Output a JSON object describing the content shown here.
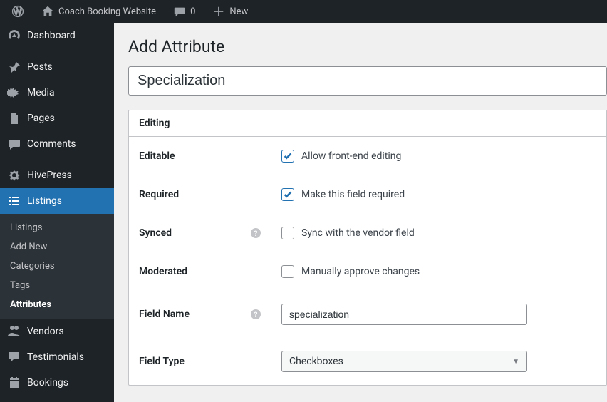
{
  "adminbar": {
    "site_name": "Coach Booking Website",
    "comments_count": "0",
    "new_label": "New"
  },
  "sidebar": {
    "dashboard": "Dashboard",
    "posts": "Posts",
    "media": "Media",
    "pages": "Pages",
    "comments": "Comments",
    "hivepress": "HivePress",
    "listings": "Listings",
    "vendors": "Vendors",
    "testimonials": "Testimonials",
    "bookings": "Bookings",
    "submenu": {
      "listings": "Listings",
      "add_new": "Add New",
      "categories": "Categories",
      "tags": "Tags",
      "attributes": "Attributes"
    }
  },
  "page": {
    "title": "Add Attribute",
    "title_input": "Specialization"
  },
  "box": {
    "header": "Editing",
    "editable": {
      "label": "Editable",
      "option": "Allow front-end editing",
      "checked": true
    },
    "required": {
      "label": "Required",
      "option": "Make this field required",
      "checked": true
    },
    "synced": {
      "label": "Synced",
      "option": "Sync with the vendor field",
      "checked": false
    },
    "moderated": {
      "label": "Moderated",
      "option": "Manually approve changes",
      "checked": false
    },
    "field_name": {
      "label": "Field Name",
      "value": "specialization"
    },
    "field_type": {
      "label": "Field Type",
      "value": "Checkboxes"
    }
  }
}
